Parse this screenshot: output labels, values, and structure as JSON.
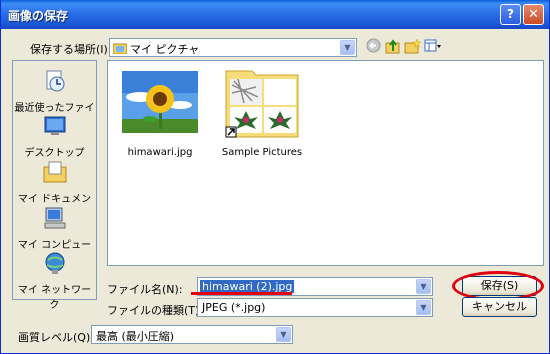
{
  "window": {
    "title": "画像の保存"
  },
  "titlebar_buttons": {
    "help": "?",
    "close": "✕"
  },
  "location": {
    "label": "保存する場所(I):",
    "value": "マイ ピクチャ"
  },
  "places": [
    {
      "label": "最近使ったファイル",
      "icon": "recent-files-icon"
    },
    {
      "label": "デスクトップ",
      "icon": "desktop-icon"
    },
    {
      "label": "マイ ドキュメント",
      "icon": "my-documents-icon"
    },
    {
      "label": "マイ コンピュータ",
      "icon": "my-computer-icon"
    },
    {
      "label": "マイ ネットワーク",
      "icon": "my-network-icon"
    }
  ],
  "files": [
    {
      "name": "himawari.jpg",
      "icon": "sunflower-thumbnail"
    },
    {
      "name": "Sample Pictures",
      "icon": "folder-thumbnail"
    }
  ],
  "filename": {
    "label": "ファイル名(N):",
    "value": "himawari (2).jpg"
  },
  "filetype": {
    "label": "ファイルの種類(T):",
    "value": "JPEG (*.jpg)"
  },
  "quality": {
    "label": "画質レベル(Q):",
    "value": "最高 (最小圧縮)"
  },
  "buttons": {
    "save": "保存(S)",
    "cancel": "キャンセル"
  },
  "colors": {
    "titlebar": "#2b70e8",
    "highlight": "#316ac5",
    "annotation": "#e0000e",
    "dialog_bg": "#ece9d8"
  }
}
